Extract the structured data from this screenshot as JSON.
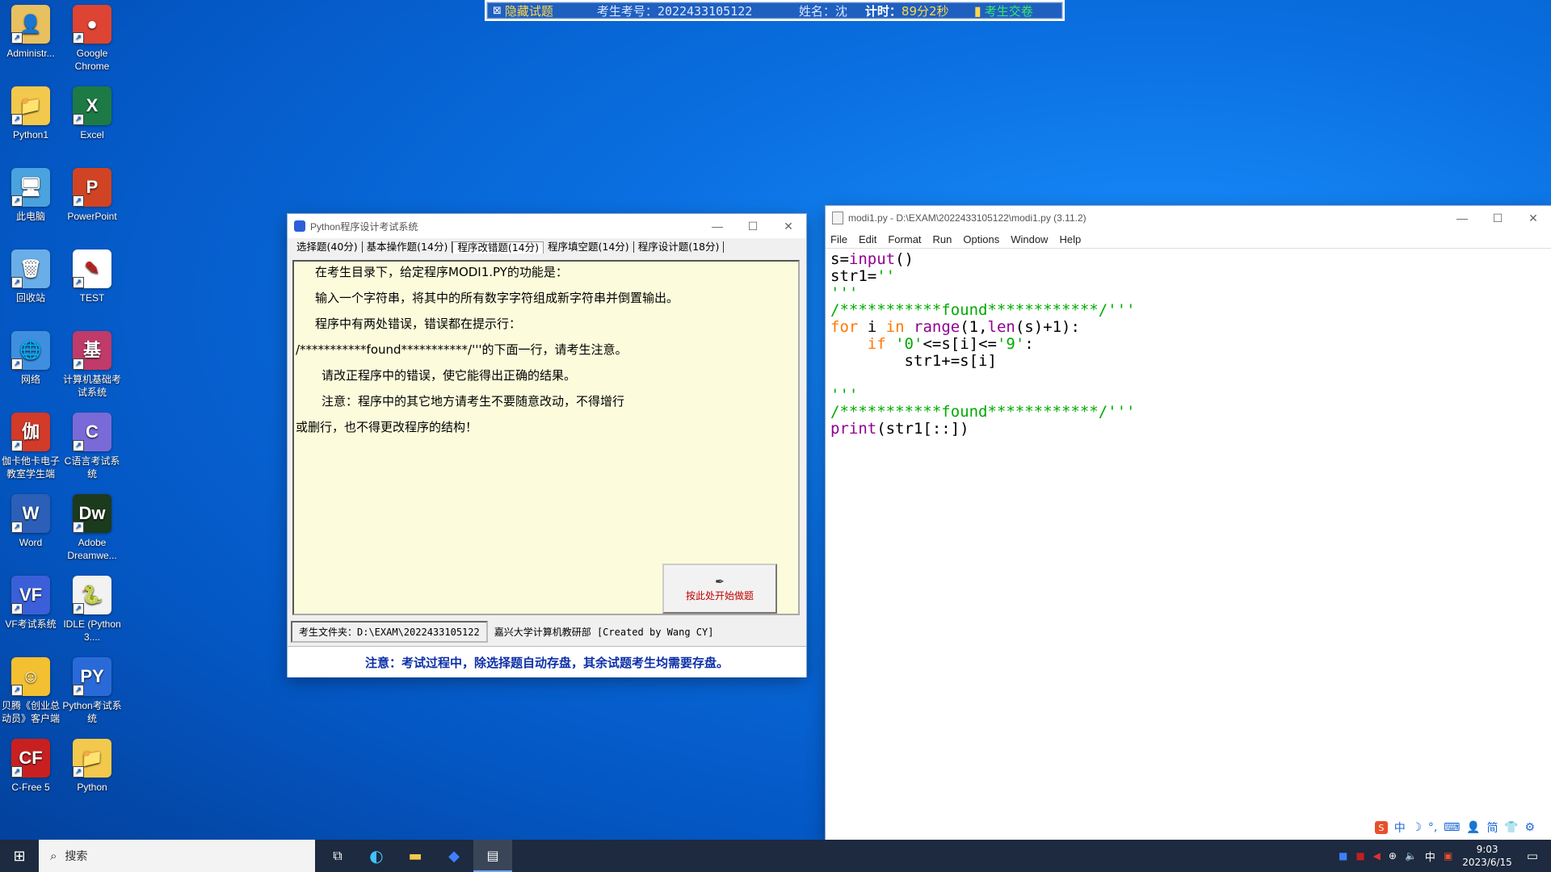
{
  "desktop": {
    "icons": [
      {
        "label": "Administr...",
        "glyph": "👤",
        "color": "#e8c060"
      },
      {
        "label": "Google Chrome",
        "glyph": "●",
        "color": "#dd4433"
      },
      {
        "label": "Python1",
        "glyph": "📁",
        "color": "#f2c94c"
      },
      {
        "label": "Excel",
        "glyph": "X",
        "color": "#1d7a44"
      },
      {
        "label": "此电脑",
        "glyph": "🖥",
        "color": "#4aa3df"
      },
      {
        "label": "PowerPoint",
        "glyph": "P",
        "color": "#d04424"
      },
      {
        "label": "回收站",
        "glyph": "🗑",
        "color": "#6aaee8"
      },
      {
        "label": "TEST",
        "glyph": "✎",
        "color": "#ffffff"
      },
      {
        "label": "网络",
        "glyph": "🌐",
        "color": "#3f8fe0"
      },
      {
        "label": "计算机基础考试系统",
        "glyph": "基",
        "color": "#c03a6a"
      },
      {
        "label": "伽卡他卡电子教室学生端",
        "glyph": "伽",
        "color": "#d23a2a"
      },
      {
        "label": "C语言考试系统",
        "glyph": "C",
        "color": "#7a6ad8"
      },
      {
        "label": "Word",
        "glyph": "W",
        "color": "#2b5fb8"
      },
      {
        "label": "Adobe Dreamwe...",
        "glyph": "Dw",
        "color": "#1c3a1c"
      },
      {
        "label": "VF考试系统",
        "glyph": "VF",
        "color": "#3a5fd8"
      },
      {
        "label": "IDLE (Python 3....",
        "glyph": "🐍",
        "color": "#f2f2f2"
      },
      {
        "label": "贝腾《创业总动员》客户端",
        "glyph": "☺",
        "color": "#f2c030"
      },
      {
        "label": "Python考试系统",
        "glyph": "PY",
        "color": "#2a6ad8"
      },
      {
        "label": "C-Free 5",
        "glyph": "CF",
        "color": "#c82020"
      },
      {
        "label": "Python",
        "glyph": "📁",
        "color": "#f2c94c"
      }
    ]
  },
  "exam_bar": {
    "hide_label": "隐藏试题",
    "id_label": "考生考号：2022433105122",
    "name_label": "姓名：沈",
    "timer_prefix": "计时：",
    "timer_value": "89分2秒",
    "submit_label": "考生交卷"
  },
  "exam_window": {
    "title": "Python程序设计考试系统",
    "tabs": [
      "选择题(40分)",
      "基本操作题(14分)",
      "程序改错题(14分)",
      "程序填空题(14分)",
      "程序设计题(18分)"
    ],
    "active_tab": 2,
    "lines": [
      "在考生目录下，给定程序MODI1.PY的功能是：",
      "输入一个字符串，将其中的所有数字字符组成新字符串并倒置输出。",
      "程序中有两处错误，错误都在提示行：",
      "/***********found***********/'''的下面一行，请考生注意。",
      "请改正程序中的错误，使它能得出正确的结果。",
      "注意：程序中的其它地方请考生不要随意改动，不得增行",
      "或删行，也不得更改程序的结构！"
    ],
    "start_button": "按此处开始做题",
    "folder_label": "考生文件夹：D:\\EXAM\\2022433105122",
    "credit": "嘉兴大学计算机教研部 [Created by Wang CY]",
    "notice": "注意：考试过程中，除选择题自动存盘，其余试题考生均需要存盘。"
  },
  "idle_window": {
    "title": "modi1.py - D:\\EXAM\\2022433105122\\modi1.py (3.11.2)",
    "menu": [
      "File",
      "Edit",
      "Format",
      "Run",
      "Options",
      "Window",
      "Help"
    ]
  },
  "taskbar": {
    "search_placeholder": "搜索",
    "time": "9:03",
    "date": "2023/6/15",
    "ime_lang": "中"
  },
  "ime_bar": {
    "items": [
      "中",
      "简"
    ]
  }
}
